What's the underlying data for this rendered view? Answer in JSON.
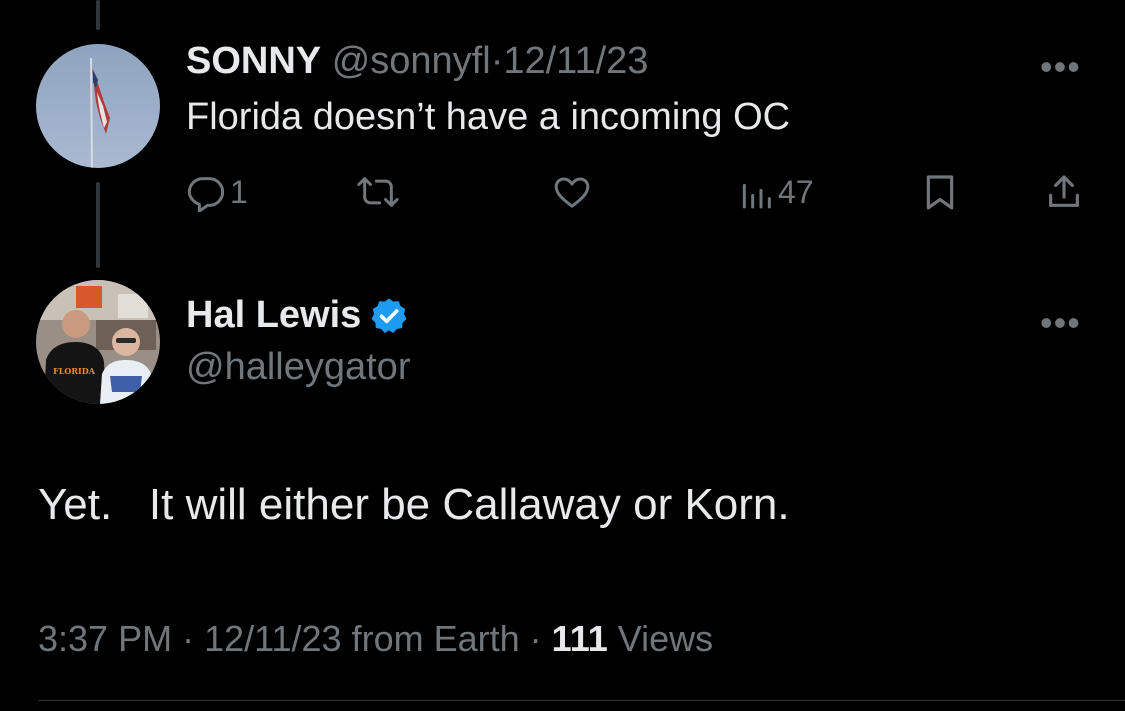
{
  "reply": {
    "display_name": "SONNY",
    "handle": "@sonnyfl",
    "separator": "·",
    "date": "12/11/23",
    "text": "Florida doesn’t have a incoming OC",
    "more_glyph": "•••",
    "actions": {
      "reply_count": "1",
      "retweet_count": "",
      "like_count": "",
      "views_count": "47"
    },
    "avatar_icon": "flag-avatar"
  },
  "tweet": {
    "display_name": "Hal Lewis",
    "handle": "@halleygator",
    "verified": true,
    "more_glyph": "•••",
    "text": "Yet.   It will either be Callaway or Korn.",
    "time": "3:37 PM",
    "separator": "·",
    "date": "12/11/23",
    "from_label": "from Earth",
    "views_count": "111",
    "views_label": "Views",
    "avatar_icon": "photo-avatar"
  },
  "colors": {
    "background": "#000000",
    "text_primary": "#e7e9ea",
    "text_muted": "#71767b",
    "verified_blue": "#1d9bf0",
    "thread_line": "#333639"
  }
}
